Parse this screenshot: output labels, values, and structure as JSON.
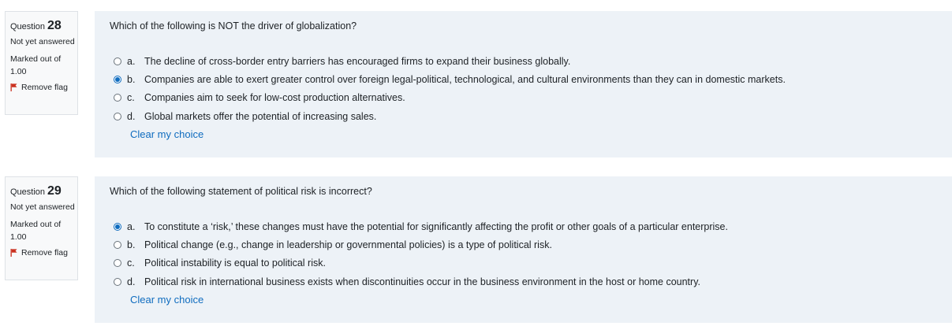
{
  "questions": [
    {
      "label": "Question",
      "number": "28",
      "state": "Not yet answered",
      "grade": "Marked out of 1.00",
      "flag_label": "Remove flag",
      "text": "Which of the following is NOT the driver of globalization?",
      "selected": 1,
      "answers": [
        {
          "letter": "a.",
          "text": "The decline of cross-border entry barriers has encouraged firms to expand their business globally."
        },
        {
          "letter": "b.",
          "text": "Companies are able to exert greater control over foreign legal-political, technological, and cultural environments than they can in domestic markets."
        },
        {
          "letter": "c.",
          "text": "Companies aim to seek for low-cost production alternatives."
        },
        {
          "letter": "d.",
          "text": "Global markets offer the potential of increasing sales."
        }
      ],
      "clear_label": "Clear my choice"
    },
    {
      "label": "Question",
      "number": "29",
      "state": "Not yet answered",
      "grade": "Marked out of 1.00",
      "flag_label": "Remove flag",
      "text": "Which of the following statement of political risk is incorrect?",
      "selected": 0,
      "answers": [
        {
          "letter": "a.",
          "text": "To constitute a ‘risk,’ these changes must have the potential for significantly affecting the profit or other goals of a particular enterprise."
        },
        {
          "letter": "b.",
          "text": "Political change (e.g., change in leadership or governmental policies) is a type of political risk."
        },
        {
          "letter": "c.",
          "text": "Political instability is equal to political risk."
        },
        {
          "letter": "d.",
          "text": "Political risk in international business exists when discontinuities occur in the business environment in the host or home country."
        }
      ],
      "clear_label": "Clear my choice"
    }
  ],
  "colors": {
    "accent": "#0f6cbf",
    "flag": "#ca3120",
    "panel": "#edf2f7",
    "info_bg": "#f8f9fa"
  },
  "icons": {
    "flag": "flag-icon"
  }
}
